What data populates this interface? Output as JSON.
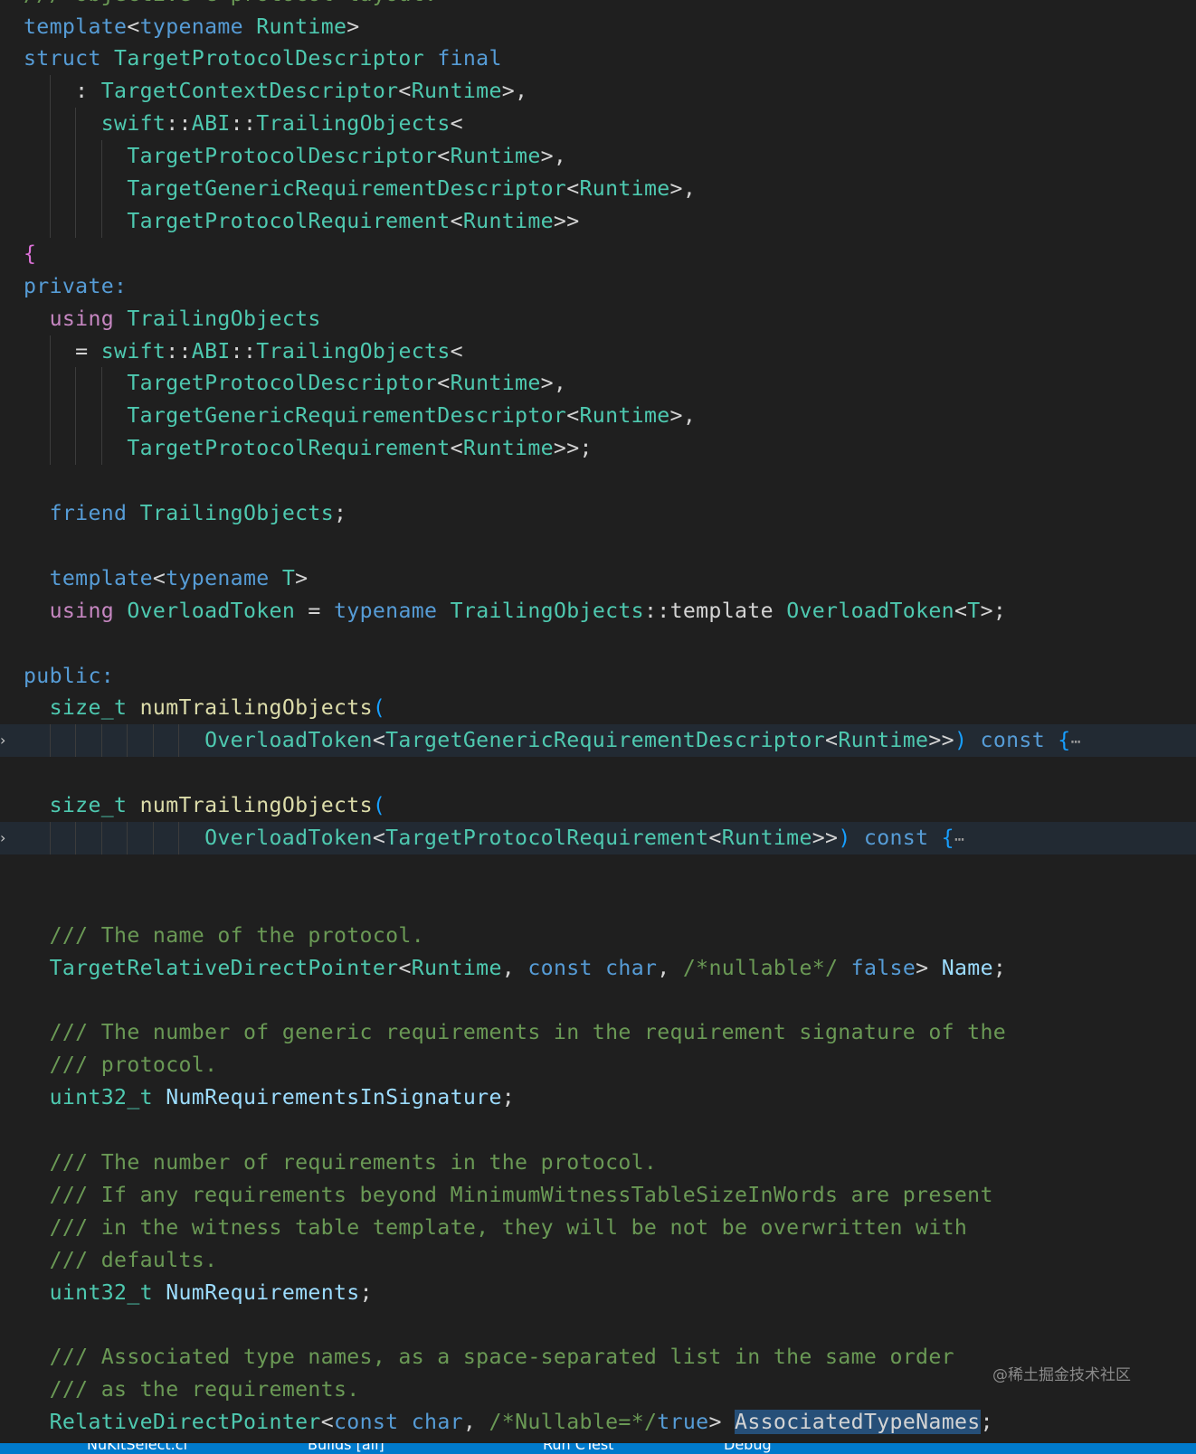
{
  "editor": {
    "language": "cpp",
    "lines": [
      {
        "fold": false,
        "segs": [
          [
            "cmt",
            "/// Objective-C protocol layout."
          ]
        ]
      },
      {
        "fold": false,
        "segs": [
          [
            "kw",
            "template"
          ],
          [
            "pun",
            "<"
          ],
          [
            "kw",
            "typename"
          ],
          [
            "pun",
            " "
          ],
          [
            "typ",
            "Runtime"
          ],
          [
            "pun",
            ">"
          ]
        ]
      },
      {
        "fold": false,
        "segs": [
          [
            "kw",
            "struct"
          ],
          [
            "pun",
            " "
          ],
          [
            "typ",
            "TargetProtocolDescriptor"
          ],
          [
            "pun",
            " "
          ],
          [
            "kw",
            "final"
          ]
        ]
      },
      {
        "fold": false,
        "segs": [
          [
            "pun",
            "    : "
          ],
          [
            "typ",
            "TargetContextDescriptor"
          ],
          [
            "pun",
            "<"
          ],
          [
            "typ",
            "Runtime"
          ],
          [
            "pun",
            ">,"
          ]
        ]
      },
      {
        "fold": false,
        "segs": [
          [
            "pun",
            "      "
          ],
          [
            "typ",
            "swift"
          ],
          [
            "pun",
            "::"
          ],
          [
            "typ",
            "ABI"
          ],
          [
            "pun",
            "::"
          ],
          [
            "typ",
            "TrailingObjects"
          ],
          [
            "pun",
            "<"
          ]
        ]
      },
      {
        "fold": false,
        "segs": [
          [
            "pun",
            "        "
          ],
          [
            "typ",
            "TargetProtocolDescriptor"
          ],
          [
            "pun",
            "<"
          ],
          [
            "typ",
            "Runtime"
          ],
          [
            "pun",
            ">,"
          ]
        ]
      },
      {
        "fold": false,
        "segs": [
          [
            "pun",
            "        "
          ],
          [
            "typ",
            "TargetGenericRequirementDescriptor"
          ],
          [
            "pun",
            "<"
          ],
          [
            "typ",
            "Runtime"
          ],
          [
            "pun",
            ">,"
          ]
        ]
      },
      {
        "fold": false,
        "segs": [
          [
            "pun",
            "        "
          ],
          [
            "typ",
            "TargetProtocolRequirement"
          ],
          [
            "pun",
            "<"
          ],
          [
            "typ",
            "Runtime"
          ],
          [
            "pun",
            ">>"
          ]
        ]
      },
      {
        "fold": false,
        "segs": [
          [
            "br1",
            "{"
          ]
        ]
      },
      {
        "fold": false,
        "segs": [
          [
            "kw",
            "private:"
          ]
        ]
      },
      {
        "fold": false,
        "segs": [
          [
            "pun",
            "  "
          ],
          [
            "ctl",
            "using"
          ],
          [
            "pun",
            " "
          ],
          [
            "typ",
            "TrailingObjects"
          ]
        ]
      },
      {
        "fold": false,
        "segs": [
          [
            "pun",
            "    = "
          ],
          [
            "typ",
            "swift"
          ],
          [
            "pun",
            "::"
          ],
          [
            "typ",
            "ABI"
          ],
          [
            "pun",
            "::"
          ],
          [
            "typ",
            "TrailingObjects"
          ],
          [
            "pun",
            "<"
          ]
        ]
      },
      {
        "fold": false,
        "segs": [
          [
            "pun",
            "        "
          ],
          [
            "typ",
            "TargetProtocolDescriptor"
          ],
          [
            "pun",
            "<"
          ],
          [
            "typ",
            "Runtime"
          ],
          [
            "pun",
            ">,"
          ]
        ]
      },
      {
        "fold": false,
        "segs": [
          [
            "pun",
            "        "
          ],
          [
            "typ",
            "TargetGenericRequirementDescriptor"
          ],
          [
            "pun",
            "<"
          ],
          [
            "typ",
            "Runtime"
          ],
          [
            "pun",
            ">,"
          ]
        ]
      },
      {
        "fold": false,
        "segs": [
          [
            "pun",
            "        "
          ],
          [
            "typ",
            "TargetProtocolRequirement"
          ],
          [
            "pun",
            "<"
          ],
          [
            "typ",
            "Runtime"
          ],
          [
            "pun",
            ">>;"
          ]
        ]
      },
      {
        "fold": false,
        "segs": []
      },
      {
        "fold": false,
        "segs": [
          [
            "pun",
            "  "
          ],
          [
            "kw",
            "friend"
          ],
          [
            "pun",
            " "
          ],
          [
            "typ",
            "TrailingObjects"
          ],
          [
            "pun",
            ";"
          ]
        ]
      },
      {
        "fold": false,
        "segs": []
      },
      {
        "fold": false,
        "segs": [
          [
            "pun",
            "  "
          ],
          [
            "kw",
            "template"
          ],
          [
            "pun",
            "<"
          ],
          [
            "kw",
            "typename"
          ],
          [
            "pun",
            " "
          ],
          [
            "typ",
            "T"
          ],
          [
            "pun",
            ">"
          ]
        ]
      },
      {
        "fold": false,
        "segs": [
          [
            "pun",
            "  "
          ],
          [
            "ctl",
            "using"
          ],
          [
            "pun",
            " "
          ],
          [
            "typ",
            "OverloadToken"
          ],
          [
            "pun",
            " = "
          ],
          [
            "kw",
            "typename"
          ],
          [
            "pun",
            " "
          ],
          [
            "typ",
            "TrailingObjects"
          ],
          [
            "pun",
            "::template "
          ],
          [
            "typ",
            "OverloadToken"
          ],
          [
            "pun",
            "<"
          ],
          [
            "typ",
            "T"
          ],
          [
            "pun",
            ">;"
          ]
        ]
      },
      {
        "fold": false,
        "segs": []
      },
      {
        "fold": false,
        "segs": [
          [
            "kw",
            "public:"
          ]
        ]
      },
      {
        "fold": false,
        "segs": [
          [
            "pun",
            "  "
          ],
          [
            "typ",
            "size_t"
          ],
          [
            "pun",
            " "
          ],
          [
            "fn",
            "numTrailingObjects"
          ],
          [
            "br2",
            "("
          ]
        ]
      },
      {
        "fold": true,
        "segs": [
          [
            "pun",
            "              "
          ],
          [
            "typ",
            "OverloadToken"
          ],
          [
            "pun",
            "<"
          ],
          [
            "typ",
            "TargetGenericRequirementDescriptor"
          ],
          [
            "pun",
            "<"
          ],
          [
            "typ",
            "Runtime"
          ],
          [
            "pun",
            ">>"
          ],
          [
            "br2",
            ")"
          ],
          [
            "pun",
            " "
          ],
          [
            "kw",
            "const"
          ],
          [
            "pun",
            " "
          ],
          [
            "br2",
            "{"
          ],
          [
            "ell",
            "⋯"
          ]
        ]
      },
      {
        "fold": false,
        "segs": []
      },
      {
        "fold": false,
        "segs": [
          [
            "pun",
            "  "
          ],
          [
            "typ",
            "size_t"
          ],
          [
            "pun",
            " "
          ],
          [
            "fn",
            "numTrailingObjects"
          ],
          [
            "br2",
            "("
          ]
        ]
      },
      {
        "fold": true,
        "segs": [
          [
            "pun",
            "              "
          ],
          [
            "typ",
            "OverloadToken"
          ],
          [
            "pun",
            "<"
          ],
          [
            "typ",
            "TargetProtocolRequirement"
          ],
          [
            "pun",
            "<"
          ],
          [
            "typ",
            "Runtime"
          ],
          [
            "pun",
            ">>"
          ],
          [
            "br2",
            ")"
          ],
          [
            "pun",
            " "
          ],
          [
            "kw",
            "const"
          ],
          [
            "pun",
            " "
          ],
          [
            "br2",
            "{"
          ],
          [
            "ell",
            "⋯"
          ]
        ]
      },
      {
        "fold": false,
        "segs": []
      },
      {
        "fold": false,
        "segs": []
      },
      {
        "fold": false,
        "segs": [
          [
            "pun",
            "  "
          ],
          [
            "cmt",
            "/// The name of the protocol."
          ]
        ]
      },
      {
        "fold": false,
        "segs": [
          [
            "pun",
            "  "
          ],
          [
            "typ",
            "TargetRelativeDirectPointer"
          ],
          [
            "pun",
            "<"
          ],
          [
            "typ",
            "Runtime"
          ],
          [
            "pun",
            ", "
          ],
          [
            "kw",
            "const"
          ],
          [
            "pun",
            " "
          ],
          [
            "kw",
            "char"
          ],
          [
            "pun",
            ", "
          ],
          [
            "cmt",
            "/*nullable*/"
          ],
          [
            "pun",
            " "
          ],
          [
            "kw",
            "false"
          ],
          [
            "pun",
            "> "
          ],
          [
            "var",
            "Name"
          ],
          [
            "pun",
            ";"
          ]
        ]
      },
      {
        "fold": false,
        "segs": []
      },
      {
        "fold": false,
        "segs": [
          [
            "pun",
            "  "
          ],
          [
            "cmt",
            "/// The number of generic requirements in the requirement signature of the"
          ]
        ]
      },
      {
        "fold": false,
        "segs": [
          [
            "pun",
            "  "
          ],
          [
            "cmt",
            "/// protocol."
          ]
        ]
      },
      {
        "fold": false,
        "segs": [
          [
            "pun",
            "  "
          ],
          [
            "typ",
            "uint32_t"
          ],
          [
            "pun",
            " "
          ],
          [
            "var",
            "NumRequirementsInSignature"
          ],
          [
            "pun",
            ";"
          ]
        ]
      },
      {
        "fold": false,
        "segs": []
      },
      {
        "fold": false,
        "segs": [
          [
            "pun",
            "  "
          ],
          [
            "cmt",
            "/// The number of requirements in the protocol."
          ]
        ]
      },
      {
        "fold": false,
        "segs": [
          [
            "pun",
            "  "
          ],
          [
            "cmt",
            "/// If any requirements beyond MinimumWitnessTableSizeInWords are present"
          ]
        ]
      },
      {
        "fold": false,
        "segs": [
          [
            "pun",
            "  "
          ],
          [
            "cmt",
            "/// in the witness table template, they will be not be overwritten with"
          ]
        ]
      },
      {
        "fold": false,
        "segs": [
          [
            "pun",
            "  "
          ],
          [
            "cmt",
            "/// defaults."
          ]
        ]
      },
      {
        "fold": false,
        "segs": [
          [
            "pun",
            "  "
          ],
          [
            "typ",
            "uint32_t"
          ],
          [
            "pun",
            " "
          ],
          [
            "var",
            "NumRequirements"
          ],
          [
            "pun",
            ";"
          ]
        ]
      },
      {
        "fold": false,
        "segs": []
      },
      {
        "fold": false,
        "segs": [
          [
            "pun",
            "  "
          ],
          [
            "cmt",
            "/// Associated type names, as a space-separated list in the same order"
          ]
        ]
      },
      {
        "fold": false,
        "segs": [
          [
            "pun",
            "  "
          ],
          [
            "cmt",
            "/// as the requirements."
          ]
        ]
      },
      {
        "fold": false,
        "segs": [
          [
            "pun",
            "  "
          ],
          [
            "typ",
            "RelativeDirectPointer"
          ],
          [
            "pun",
            "<"
          ],
          [
            "kw",
            "const"
          ],
          [
            "pun",
            " "
          ],
          [
            "kw",
            "char"
          ],
          [
            "pun",
            ", "
          ],
          [
            "cmt",
            "/*Nullable=*/"
          ],
          [
            "kw",
            "true"
          ],
          [
            "pun",
            "> "
          ],
          [
            "sel",
            "AssociatedTypeNames"
          ],
          [
            "pun",
            ";"
          ]
        ]
      }
    ]
  },
  "watermark": "@稀土掘金技术社区",
  "statusbar": {
    "items": [
      "NuKitSelect.cl",
      "Builds [all]",
      "Run CTest",
      "Debug"
    ]
  }
}
